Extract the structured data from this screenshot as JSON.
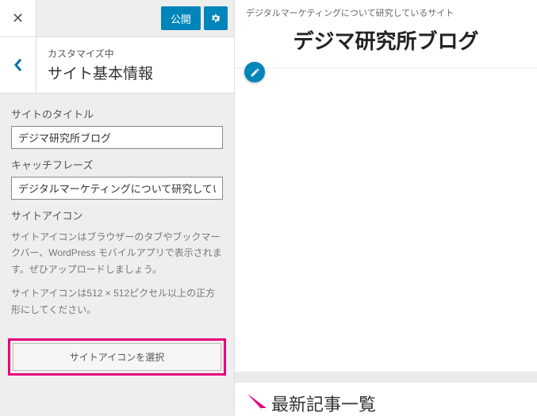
{
  "topbar": {
    "publish_label": "公開",
    "close_icon": "✕"
  },
  "header": {
    "subtitle": "カスタマイズ中",
    "title": "サイト基本情報"
  },
  "fields": {
    "site_title_label": "サイトのタイトル",
    "site_title_value": "デジマ研究所ブログ",
    "tagline_label": "キャッチフレーズ",
    "tagline_value": "デジタルマーケティングについて研究しているサイト",
    "site_icon_label": "サイトアイコン",
    "site_icon_desc1": "サイトアイコンはブラウザーのタブやブックマークバー、WordPress モバイルアプリで表示されます。ぜひアップロードしましょう。",
    "site_icon_desc2": "サイトアイコンは512 × 512ピクセル以上の正方形にしてください。",
    "select_icon_button": "サイトアイコンを選択"
  },
  "preview": {
    "site_desc": "デジタルマーケティングについて研究しているサイト",
    "site_title": "デジマ研究所ブログ",
    "latest_heading": "最新記事一覧"
  }
}
